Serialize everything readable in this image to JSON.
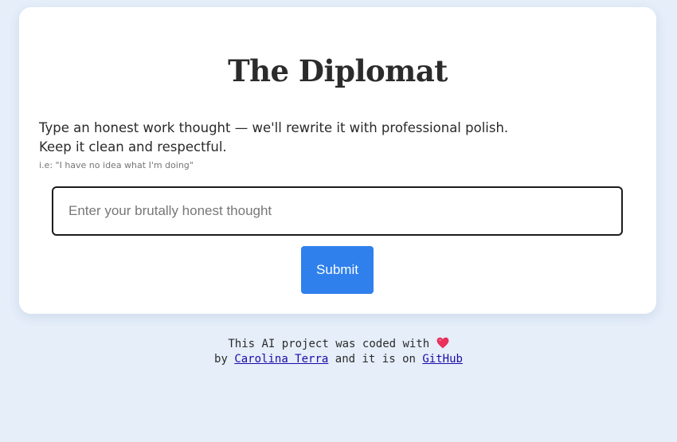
{
  "card": {
    "title": "The Diplomat",
    "description_line1": "Type an honest work thought — we'll rewrite it with professional polish.",
    "description_line2": "Keep it clean and respectful.",
    "example": "i.e: \"I have no idea what I'm doing\"",
    "input": {
      "placeholder": "Enter your brutally honest thought",
      "value": ""
    },
    "submit_label": "Submit"
  },
  "footer": {
    "line1_text": "This AI project was coded with",
    "heart_icon": "heart-icon",
    "line2_prefix": "by",
    "author_link": "Carolina Terra",
    "line2_middle": "and it is on",
    "github_link": "GitHub"
  },
  "colors": {
    "background": "#e5eef9",
    "card": "#ffffff",
    "accent": "#2f80ed",
    "heart": "#e8315b",
    "link": "#1a0dab"
  }
}
